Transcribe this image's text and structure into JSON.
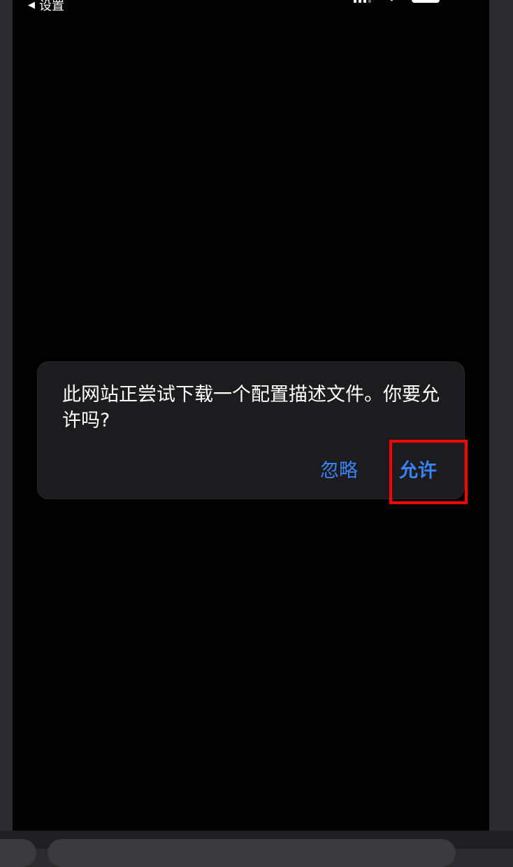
{
  "status_bar": {
    "back_label": "设置",
    "back_icon": "left-triangle-icon",
    "icons": [
      "signal-icon",
      "wifi-icon",
      "battery-icon"
    ]
  },
  "alert": {
    "message": "此网站正尝试下载一个配置描述文件。你要允许吗?",
    "ignore_label": "忽略",
    "allow_label": "允许",
    "accent_color": "#3a82f7",
    "highlight_color": "#ff0000"
  }
}
